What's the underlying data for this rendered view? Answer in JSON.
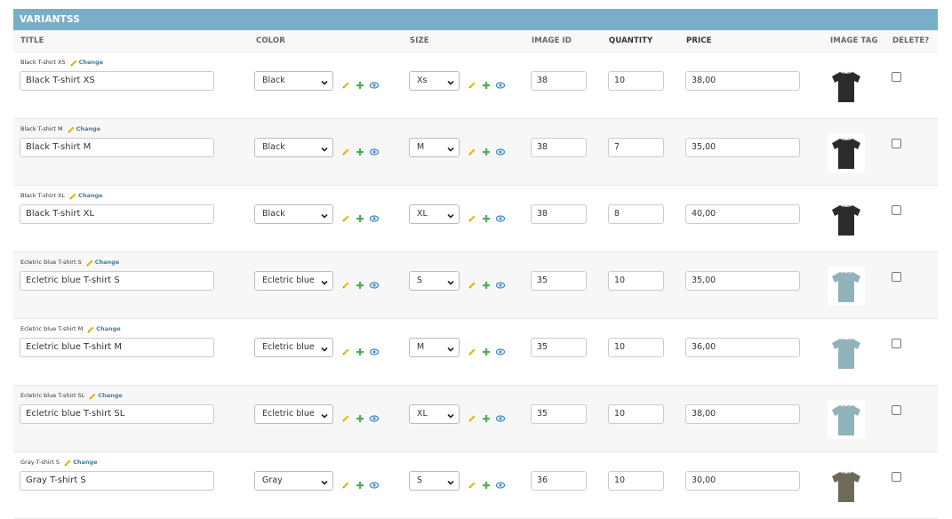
{
  "section": {
    "title": "VARIANTSS"
  },
  "columns": {
    "title": "TITLE",
    "color": "COLOR",
    "size": "SIZE",
    "image_id": "IMAGE ID",
    "quantity": "QUANTITY",
    "price": "PRICE",
    "image_tag": "IMAGE TAG",
    "delete": "DELETE?"
  },
  "change_label": "Change",
  "rows": [
    {
      "object_name": "Black T-shirt XS",
      "title": "Black T-shirt XS",
      "color": "Black",
      "size": "Xs",
      "image_id": "38",
      "quantity": "10",
      "price": "38,00",
      "shirt_color": "#2b2b2b",
      "delete": false
    },
    {
      "object_name": "Black T-shirt M",
      "title": "Black T-shirt M",
      "color": "Black",
      "size": "M",
      "image_id": "38",
      "quantity": "7",
      "price": "35,00",
      "shirt_color": "#2b2b2b",
      "delete": false
    },
    {
      "object_name": "Black T-shirt XL",
      "title": "Black T-shirt XL",
      "color": "Black",
      "size": "XL",
      "image_id": "38",
      "quantity": "8",
      "price": "40,00",
      "shirt_color": "#2b2b2b",
      "delete": false
    },
    {
      "object_name": "Ecletric blue T-shirt S",
      "title": "Ecletric blue T-shirt S",
      "color": "Ecletric blue",
      "size": "S",
      "image_id": "35",
      "quantity": "10",
      "price": "35,00",
      "shirt_color": "#8fb3b8",
      "delete": false
    },
    {
      "object_name": "Ecletric blue T-shirt M",
      "title": "Ecletric blue T-shirt M",
      "color": "Ecletric blue",
      "size": "M",
      "image_id": "35",
      "quantity": "10",
      "price": "36,00",
      "shirt_color": "#8fb3b8",
      "delete": false
    },
    {
      "object_name": "Ecletric blue T-shirt SL",
      "title": "Ecletric blue T-shirt SL",
      "color": "Ecletric blue",
      "size": "XL",
      "image_id": "35",
      "quantity": "10",
      "price": "38,00",
      "shirt_color": "#8fb3b8",
      "delete": false
    },
    {
      "object_name": "Gray T-shirt S",
      "title": "Gray T-shirt S",
      "color": "Gray",
      "size": "S",
      "image_id": "36",
      "quantity": "10",
      "price": "30,00",
      "shirt_color": "#6e6a58",
      "delete": false
    }
  ],
  "colors": {
    "header_bg": "#79aec8",
    "link": "#447e9b",
    "pencil": "#e6b800",
    "plus": "#4caf50",
    "eye": "#3a83c7"
  }
}
